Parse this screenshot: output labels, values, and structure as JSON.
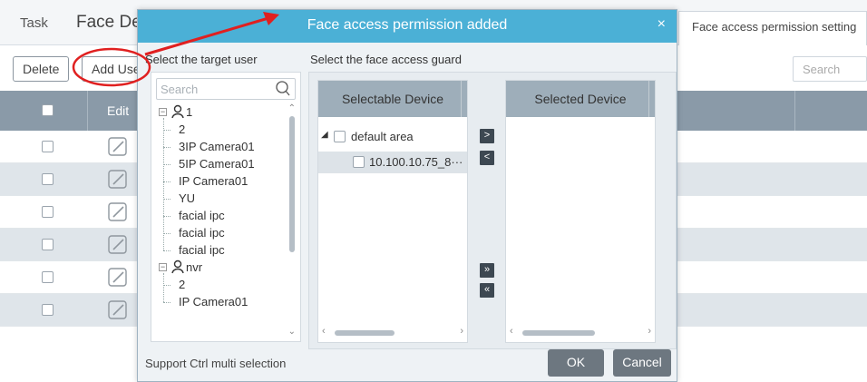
{
  "background": {
    "task_label": "Task",
    "page_title": "Face De",
    "right_tab": "Face access permission setting",
    "delete_label": "Delete",
    "add_user_label": "Add Use",
    "search_placeholder": "Search",
    "table_header_edit": "Edit",
    "row_count": 6
  },
  "dialog": {
    "title": "Face access permission added",
    "close_icon": "×",
    "user_section_label": "Select the target user",
    "guard_section_label": "Select the face access guard",
    "user_search_placeholder": "Search",
    "user_tree": [
      {
        "label": "1",
        "type": "user-group"
      },
      {
        "label": "2"
      },
      {
        "label": "3IP Camera01"
      },
      {
        "label": "5IP Camera01"
      },
      {
        "label": "IP Camera01"
      },
      {
        "label": "YU"
      },
      {
        "label": "facial ipc"
      },
      {
        "label": "facial ipc"
      },
      {
        "label": "facial ipc"
      },
      {
        "label": "nvr",
        "type": "user-group"
      },
      {
        "label": "2"
      },
      {
        "label": "IP Camera01"
      }
    ],
    "selectable_header": "Selectable Device",
    "selected_header": "Selected Device",
    "area_label": "default area",
    "device_label": "10.100.10.75_8···",
    "move_right": ">",
    "move_left": "<",
    "move_all_right": "»",
    "move_all_left": "«",
    "footer_hint": "Support Ctrl multi selection",
    "ok_label": "OK",
    "cancel_label": "Cancel"
  },
  "colors": {
    "dialog_header": "#4bb0d6",
    "table_header": "#8a9aa8",
    "annotation": "#e02020"
  }
}
